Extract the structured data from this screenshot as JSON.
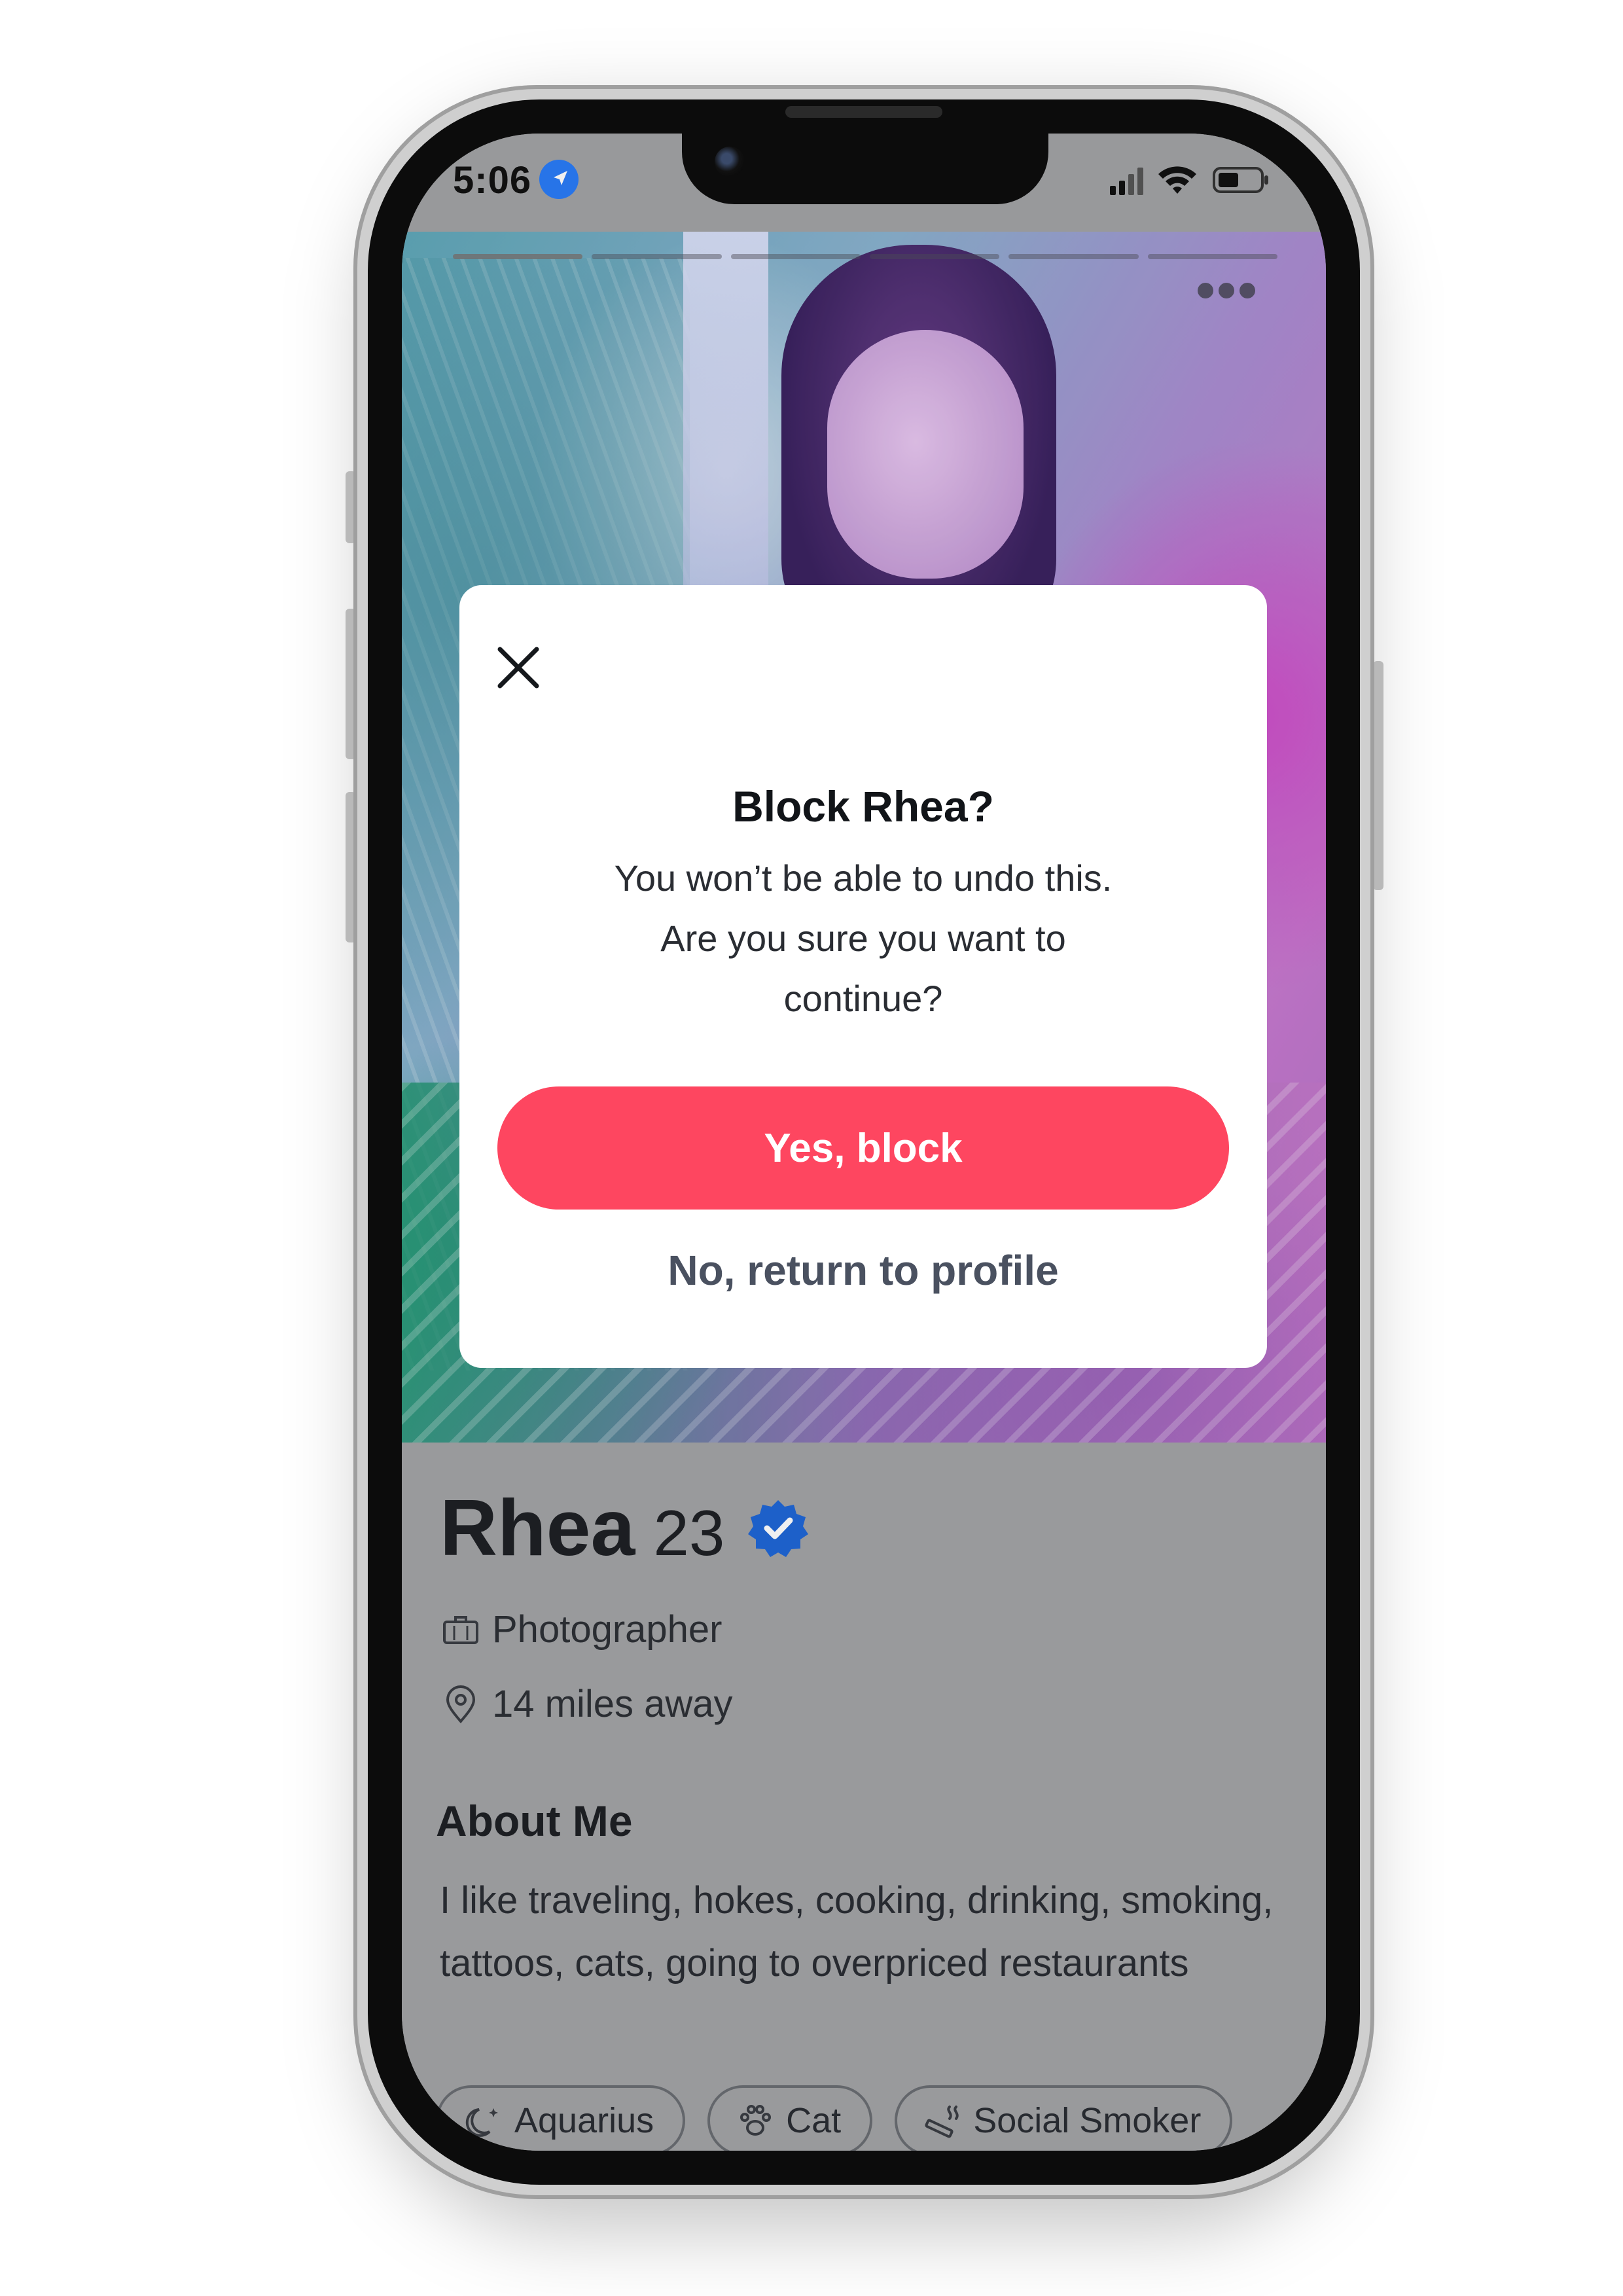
{
  "status_bar": {
    "time": "5:06",
    "location_icon": "location-arrow-icon",
    "signal_icon": "cellular-signal-icon",
    "wifi_icon": "wifi-icon",
    "battery_icon": "battery-icon"
  },
  "photo": {
    "photo_count": 6,
    "current_photo": 1,
    "menu_icon": "more-dots-icon"
  },
  "dialog": {
    "title": "Block Rhea?",
    "message_line1": "You won’t be able to undo this.",
    "message_line2": "Are you sure you want to",
    "message_line3": "continue?",
    "confirm_label": "Yes, block",
    "cancel_label": "No, return to profile",
    "close_icon": "close-icon"
  },
  "profile": {
    "name": "Rhea",
    "age": "23",
    "verified_icon": "verified-badge-icon",
    "job_icon": "briefcase-icon",
    "job": "Photographer",
    "distance_icon": "location-pin-icon",
    "distance": "14 miles away"
  },
  "about": {
    "title": "About Me",
    "text": "I like traveling, hokes, cooking, drinking, smoking, tattoos, cats, going to overpriced restaurants"
  },
  "chips": [
    {
      "icon": "moon-icon",
      "label": "Aquarius"
    },
    {
      "icon": "paw-icon",
      "label": "Cat"
    },
    {
      "icon": "smoking-icon",
      "label": "Social Smoker"
    }
  ],
  "colors": {
    "accent": "#fe4660",
    "verified": "#1f67d6",
    "overlay_background": "#a3a4a6"
  }
}
